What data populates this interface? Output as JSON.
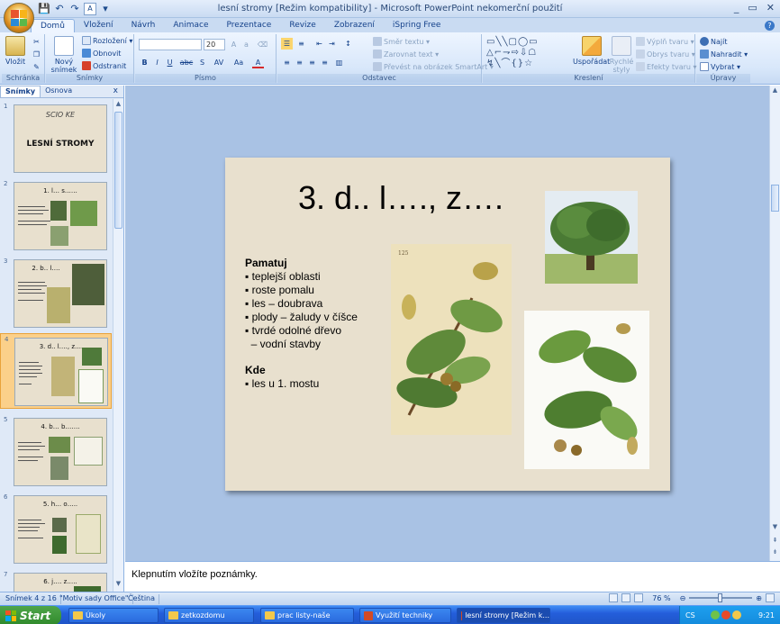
{
  "window": {
    "title": "lesní stromy [Režim kompatibility] - Microsoft PowerPoint nekomerční použití",
    "qat": [
      "💾",
      "↶",
      "↷",
      "A",
      "▾"
    ],
    "controls": [
      "_",
      "▭",
      "✕"
    ]
  },
  "tabs": [
    "Domů",
    "Vložení",
    "Návrh",
    "Animace",
    "Prezentace",
    "Revize",
    "Zobrazení",
    "iSpring Free"
  ],
  "ribbon": {
    "clipboard": {
      "label": "Schránka",
      "paste": "Vložit"
    },
    "slides": {
      "label": "Snímky",
      "new_slide": "Nový snímek",
      "layout": "Rozložení ▾",
      "reset": "Obnovit",
      "delete": "Odstranit"
    },
    "font": {
      "label": "Písmo",
      "font_name": "",
      "font_size": "20",
      "buttons": [
        "B",
        "I",
        "U",
        "abc",
        "S",
        "AV",
        "Aa",
        "A"
      ]
    },
    "paragraph": {
      "label": "Odstavec",
      "text_direction": "Směr textu ▾",
      "align_text": "Zarovnat text ▾",
      "smartart": "Převést na obrázek SmartArt ▾"
    },
    "drawing": {
      "label": "Kreslení",
      "arrange": "Uspořádat",
      "quick_styles": "Rychlé styly",
      "shape_fill": "Výplň tvaru ▾",
      "shape_outline": "Obrys tvaru ▾",
      "shape_effects": "Efekty tvaru ▾"
    },
    "editing": {
      "label": "Úpravy",
      "find": "Najít",
      "replace": "Nahradit ▾",
      "select": "Vybrat ▾"
    }
  },
  "left_panel": {
    "tabs": [
      "Snímky",
      "Osnova"
    ],
    "close": "x",
    "slides": [
      {
        "num": "1",
        "title": "LESNÍ STROMY",
        "logo": "SCIO KE"
      },
      {
        "num": "2",
        "title": "1. l… s……"
      },
      {
        "num": "3",
        "title": "2. b.. l…."
      },
      {
        "num": "4",
        "title": "3. d.. l…., z…."
      },
      {
        "num": "5",
        "title": "4. b… b……."
      },
      {
        "num": "6",
        "title": "5. h… o….."
      },
      {
        "num": "7",
        "title": "6. j…. z….."
      }
    ]
  },
  "slide": {
    "title": "3. d.. l…., z….",
    "body": [
      {
        "text": "Pamatuj",
        "bold": true
      },
      {
        "text": "▪ teplejší oblasti"
      },
      {
        "text": "▪ roste pomalu"
      },
      {
        "text": "▪ les – doubrava"
      },
      {
        "text": "▪ plody – žaludy v číšce"
      },
      {
        "text": "▪ tvrdé odolné dřevo"
      },
      {
        "text": "  – vodní stavby"
      },
      {
        "text": "",
        "gap": true
      },
      {
        "text": "Kde",
        "bold": true
      },
      {
        "text": "▪ les u 1. mostu"
      }
    ]
  },
  "notes": {
    "placeholder": "Klepnutím vložíte poznámky."
  },
  "status": {
    "slide_info": "Snímek 4 z 16",
    "theme": "\"Motiv sady Office\"",
    "language": "Čeština",
    "zoom": "76 %"
  },
  "taskbar": {
    "start": "Start",
    "items": [
      "Úkoly",
      "zetkozdomu",
      "prac listy-naše",
      "Využití techniky",
      "lesní stromy [Režim k..."
    ],
    "tray_lang": "CS",
    "clock": "9:21"
  },
  "colors": {
    "ribbon": "#d8e7fa",
    "slide_bg": "#e8e0ce",
    "workspace": "#a9c2e4",
    "taskbar": "#245edb"
  }
}
